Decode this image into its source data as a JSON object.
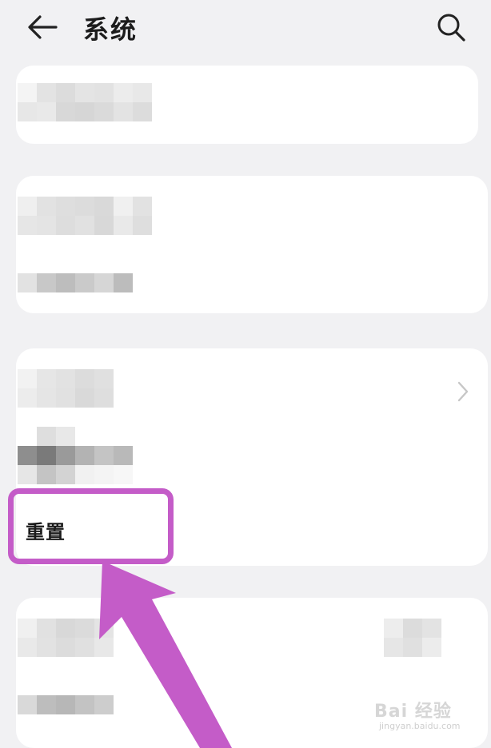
{
  "header": {
    "title": "系统",
    "back_icon": "arrow-left-icon",
    "search_icon": "search-icon"
  },
  "rows": {
    "reset_label": "重置"
  },
  "watermark": {
    "brand": "Bai 经验",
    "url": "jingyan.baidu.com"
  },
  "colors": {
    "background": "#f1f1f3",
    "card": "#ffffff",
    "highlight": "#c45cc8",
    "text": "#1b1b1b"
  }
}
